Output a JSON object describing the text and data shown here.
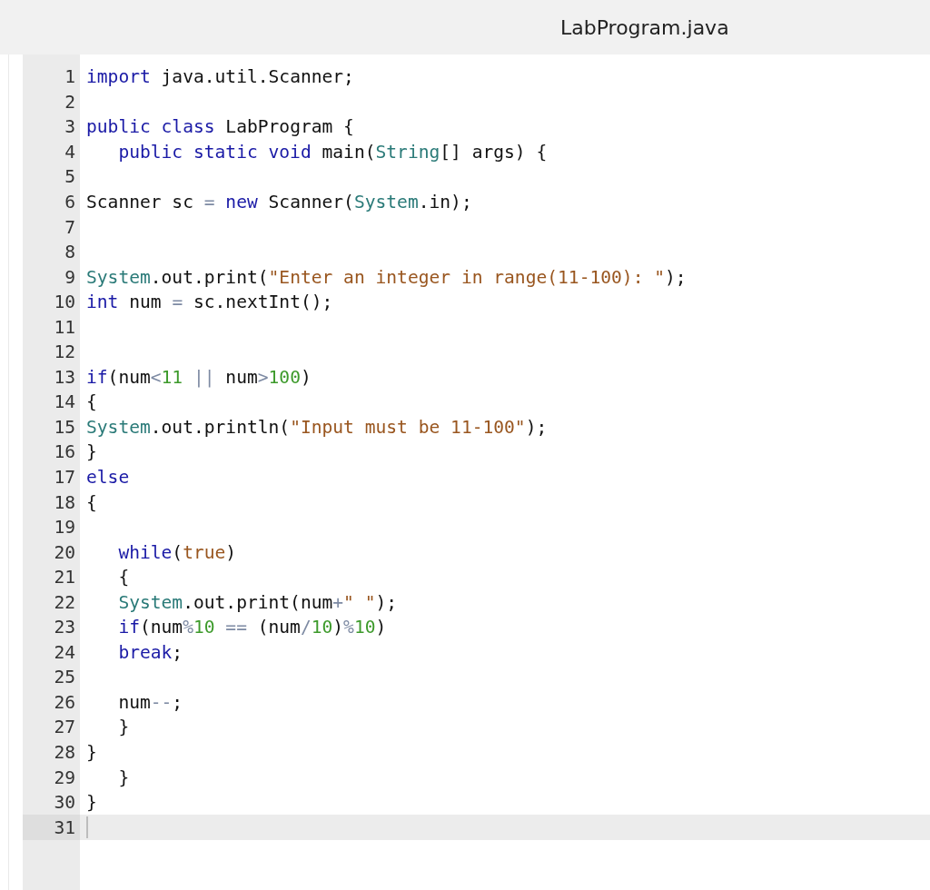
{
  "file_tab": {
    "title": "LabProgram.java"
  },
  "editor": {
    "lines": [
      {
        "number": "1",
        "active": false,
        "indented": false,
        "tokens": [
          {
            "kind": "kw",
            "text": "import"
          },
          {
            "kind": "plain",
            "text": " java.util.Scanner;"
          }
        ]
      },
      {
        "number": "2",
        "active": false
      },
      {
        "number": "3",
        "active": false,
        "indented": false,
        "tokens": [
          {
            "kind": "kw",
            "text": "public class"
          },
          {
            "kind": "plain",
            "text": " LabProgram {"
          }
        ]
      },
      {
        "number": "4",
        "active": false,
        "indented": true,
        "tokens": [
          {
            "kind": "kw",
            "text": "public static void"
          },
          {
            "kind": "plain",
            "text": " main("
          },
          {
            "kind": "type",
            "text": "String"
          },
          {
            "kind": "plain",
            "text": "[] args) {"
          }
        ]
      },
      {
        "number": "5",
        "active": false
      },
      {
        "number": "6",
        "active": false,
        "indented": false,
        "tokens": [
          {
            "kind": "plain",
            "text": "Scanner sc "
          },
          {
            "kind": "op",
            "text": "="
          },
          {
            "kind": "kw",
            "text": " new"
          },
          {
            "kind": "plain",
            "text": " Scanner("
          },
          {
            "kind": "type",
            "text": "System"
          },
          {
            "kind": "plain",
            "text": ".in);"
          }
        ]
      },
      {
        "number": "7",
        "active": false
      },
      {
        "number": "8",
        "active": false
      },
      {
        "number": "9",
        "active": false,
        "indented": false,
        "tokens": [
          {
            "kind": "type",
            "text": "System"
          },
          {
            "kind": "plain",
            "text": ".out.print("
          },
          {
            "kind": "str",
            "text": "\"Enter an integer in range(11-100): \""
          },
          {
            "kind": "plain",
            "text": ");"
          }
        ]
      },
      {
        "number": "10",
        "active": false,
        "indented": false,
        "tokens": [
          {
            "kind": "kw",
            "text": "int"
          },
          {
            "kind": "plain",
            "text": " num "
          },
          {
            "kind": "op",
            "text": "="
          },
          {
            "kind": "plain",
            "text": " sc.nextInt();"
          }
        ]
      },
      {
        "number": "11",
        "active": false
      },
      {
        "number": "12",
        "active": false
      },
      {
        "number": "13",
        "active": false,
        "indented": false,
        "tokens": [
          {
            "kind": "kw",
            "text": "if"
          },
          {
            "kind": "plain",
            "text": "(num"
          },
          {
            "kind": "op",
            "text": "<"
          },
          {
            "kind": "num",
            "text": "11"
          },
          {
            "kind": "op",
            "text": " ||"
          },
          {
            "kind": "plain",
            "text": " num"
          },
          {
            "kind": "op",
            "text": ">"
          },
          {
            "kind": "num",
            "text": "100"
          },
          {
            "kind": "plain",
            "text": ")"
          }
        ]
      },
      {
        "number": "14",
        "active": false,
        "indented": false,
        "tokens": [
          {
            "kind": "plain",
            "text": "{"
          }
        ]
      },
      {
        "number": "15",
        "active": false,
        "indented": false,
        "tokens": [
          {
            "kind": "type",
            "text": "System"
          },
          {
            "kind": "plain",
            "text": ".out.println("
          },
          {
            "kind": "str",
            "text": "\"Input must be 11-100\""
          },
          {
            "kind": "plain",
            "text": ");"
          }
        ]
      },
      {
        "number": "16",
        "active": false,
        "indented": false,
        "tokens": [
          {
            "kind": "plain",
            "text": "}"
          }
        ]
      },
      {
        "number": "17",
        "active": false,
        "indented": false,
        "tokens": [
          {
            "kind": "kw",
            "text": "else"
          }
        ]
      },
      {
        "number": "18",
        "active": false,
        "indented": false,
        "tokens": [
          {
            "kind": "plain",
            "text": "{"
          }
        ]
      },
      {
        "number": "19",
        "active": false
      },
      {
        "number": "20",
        "active": false,
        "indented": true,
        "tokens": [
          {
            "kind": "kw",
            "text": "while"
          },
          {
            "kind": "plain",
            "text": "("
          },
          {
            "kind": "str",
            "text": "true"
          },
          {
            "kind": "plain",
            "text": ")"
          }
        ]
      },
      {
        "number": "21",
        "active": false,
        "indented": true,
        "tokens": [
          {
            "kind": "plain",
            "text": "{"
          }
        ]
      },
      {
        "number": "22",
        "active": false,
        "indented": true,
        "tokens": [
          {
            "kind": "type",
            "text": "System"
          },
          {
            "kind": "plain",
            "text": ".out.print(num"
          },
          {
            "kind": "op",
            "text": "+"
          },
          {
            "kind": "str",
            "text": "\" \""
          },
          {
            "kind": "plain",
            "text": ");"
          }
        ]
      },
      {
        "number": "23",
        "active": false,
        "indented": true,
        "tokens": [
          {
            "kind": "kw",
            "text": "if"
          },
          {
            "kind": "plain",
            "text": "(num"
          },
          {
            "kind": "op",
            "text": "%"
          },
          {
            "kind": "num",
            "text": "10"
          },
          {
            "kind": "op",
            "text": " =="
          },
          {
            "kind": "plain",
            "text": " (num"
          },
          {
            "kind": "op",
            "text": "/"
          },
          {
            "kind": "num",
            "text": "10"
          },
          {
            "kind": "plain",
            "text": ")"
          },
          {
            "kind": "op",
            "text": "%"
          },
          {
            "kind": "num",
            "text": "10"
          },
          {
            "kind": "plain",
            "text": ")"
          }
        ]
      },
      {
        "number": "24",
        "active": false,
        "indented": true,
        "tokens": [
          {
            "kind": "kw",
            "text": "break"
          },
          {
            "kind": "plain",
            "text": ";"
          }
        ]
      },
      {
        "number": "25",
        "active": false
      },
      {
        "number": "26",
        "active": false,
        "indented": true,
        "tokens": [
          {
            "kind": "plain",
            "text": "num"
          },
          {
            "kind": "op",
            "text": "--"
          },
          {
            "kind": "plain",
            "text": ";"
          }
        ]
      },
      {
        "number": "27",
        "active": false,
        "indented": true,
        "tokens": [
          {
            "kind": "plain",
            "text": "}"
          }
        ]
      },
      {
        "number": "28",
        "active": false,
        "indented": false,
        "tokens": [
          {
            "kind": "plain",
            "text": "}"
          }
        ]
      },
      {
        "number": "29",
        "active": false,
        "indented": true,
        "tokens": [
          {
            "kind": "plain",
            "text": "}"
          }
        ]
      },
      {
        "number": "30",
        "active": false,
        "indented": false,
        "tokens": [
          {
            "kind": "plain",
            "text": "}"
          }
        ]
      },
      {
        "number": "31",
        "active": true
      }
    ]
  }
}
